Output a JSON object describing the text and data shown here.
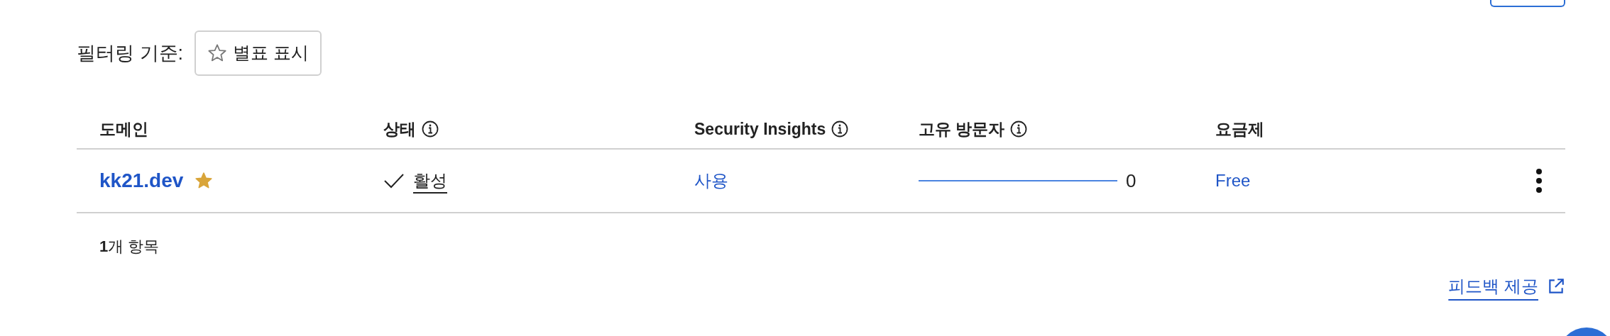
{
  "filter": {
    "label": "필터링 기준:",
    "button": {
      "label": "별표 표시"
    }
  },
  "table": {
    "columns": [
      {
        "label": "도메인",
        "info": false
      },
      {
        "label": "상태",
        "info": true
      },
      {
        "label": "Security Insights",
        "info": true
      },
      {
        "label": "고유 방문자",
        "info": true
      },
      {
        "label": "요금제",
        "info": false
      }
    ],
    "rows": [
      {
        "domain": "kk21.dev",
        "starred": true,
        "active": true,
        "status": "활성",
        "security": "사용",
        "visitors": "0",
        "plan": "Free"
      }
    ]
  },
  "count": "**1**개 항목",
  "feedback_link": "피드백 제공"
}
